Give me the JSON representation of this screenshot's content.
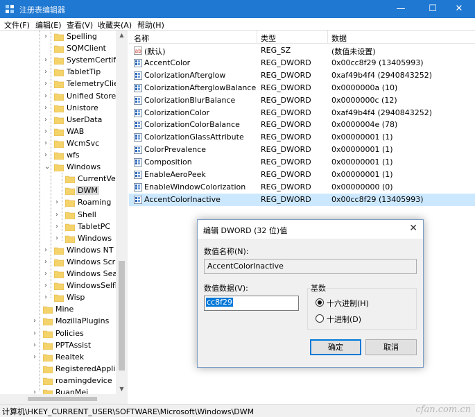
{
  "window": {
    "title": "注册表编辑器",
    "minimize": "—",
    "maximize": "☐",
    "close": "✕"
  },
  "menu": [
    "文件(F)",
    "编辑(E)",
    "查看(V)",
    "收藏夹(A)",
    "帮助(H)"
  ],
  "tree": {
    "items": [
      {
        "label": "Spelling",
        "expander": ">"
      },
      {
        "label": "SQMClient",
        "expander": ""
      },
      {
        "label": "SystemCertifi",
        "expander": ">"
      },
      {
        "label": "TabletTip",
        "expander": ">"
      },
      {
        "label": "TelemetryClie",
        "expander": ">"
      },
      {
        "label": "Unified Store",
        "expander": ">"
      },
      {
        "label": "Unistore",
        "expander": ">"
      },
      {
        "label": "UserData",
        "expander": ">"
      },
      {
        "label": "WAB",
        "expander": ">"
      },
      {
        "label": "WcmSvc",
        "expander": ">"
      },
      {
        "label": "wfs",
        "expander": ">"
      },
      {
        "label": "Windows",
        "expander": "v"
      },
      {
        "label": "CurrentVe",
        "expander": ""
      },
      {
        "label": "DWM",
        "expander": ""
      },
      {
        "label": "Roaming",
        "expander": ">"
      },
      {
        "label": "Shell",
        "expander": ">"
      },
      {
        "label": "TabletPC",
        "expander": ">"
      },
      {
        "label": "Windows",
        "expander": ">"
      },
      {
        "label": "Windows NT",
        "expander": ">"
      },
      {
        "label": "Windows Scr",
        "expander": ">"
      },
      {
        "label": "Windows Sea",
        "expander": ">"
      },
      {
        "label": "WindowsSelfl",
        "expander": ">"
      },
      {
        "label": "Wisp",
        "expander": ">"
      },
      {
        "label": "Mine",
        "expander": ""
      },
      {
        "label": "MozillaPlugins",
        "expander": ">"
      },
      {
        "label": "Policies",
        "expander": ">"
      },
      {
        "label": "PPTAssist",
        "expander": ">"
      },
      {
        "label": "Realtek",
        "expander": ">"
      },
      {
        "label": "RegisteredAppli",
        "expander": ""
      },
      {
        "label": "roamingdevice",
        "expander": ""
      },
      {
        "label": "RuanMei",
        "expander": ">"
      }
    ],
    "selected": "DWM"
  },
  "list": {
    "columns": {
      "name": "名称",
      "type": "类型",
      "data": "数据"
    },
    "rows": [
      {
        "name": "(默认)",
        "type": "REG_SZ",
        "data": "(数值未设置)",
        "icon": "string-value-icon"
      },
      {
        "name": "AccentColor",
        "type": "REG_DWORD",
        "data": "0x00cc8f29 (13405993)",
        "icon": "binary-value-icon"
      },
      {
        "name": "ColorizationAfterglow",
        "type": "REG_DWORD",
        "data": "0xaf49b4f4 (2940843252)",
        "icon": "binary-value-icon"
      },
      {
        "name": "ColorizationAfterglowBalance",
        "type": "REG_DWORD",
        "data": "0x0000000a (10)",
        "icon": "binary-value-icon"
      },
      {
        "name": "ColorizationBlurBalance",
        "type": "REG_DWORD",
        "data": "0x0000000c (12)",
        "icon": "binary-value-icon"
      },
      {
        "name": "ColorizationColor",
        "type": "REG_DWORD",
        "data": "0xaf49b4f4 (2940843252)",
        "icon": "binary-value-icon"
      },
      {
        "name": "ColorizationColorBalance",
        "type": "REG_DWORD",
        "data": "0x0000004e (78)",
        "icon": "binary-value-icon"
      },
      {
        "name": "ColorizationGlassAttribute",
        "type": "REG_DWORD",
        "data": "0x00000001 (1)",
        "icon": "binary-value-icon"
      },
      {
        "name": "ColorPrevalence",
        "type": "REG_DWORD",
        "data": "0x00000001 (1)",
        "icon": "binary-value-icon"
      },
      {
        "name": "Composition",
        "type": "REG_DWORD",
        "data": "0x00000001 (1)",
        "icon": "binary-value-icon"
      },
      {
        "name": "EnableAeroPeek",
        "type": "REG_DWORD",
        "data": "0x00000001 (1)",
        "icon": "binary-value-icon"
      },
      {
        "name": "EnableWindowColorization",
        "type": "REG_DWORD",
        "data": "0x00000000 (0)",
        "icon": "binary-value-icon"
      },
      {
        "name": "AccentColorInactive",
        "type": "REG_DWORD",
        "data": "0x00cc8f29 (13405993)",
        "icon": "binary-value-icon"
      }
    ],
    "selected": "AccentColorInactive"
  },
  "status": {
    "path": "计算机\\HKEY_CURRENT_USER\\SOFTWARE\\Microsoft\\Windows\\DWM",
    "watermark": "cfan.com.cn"
  },
  "dialog": {
    "title": "编辑 DWORD (32 位)值",
    "name_label": "数值名称(N):",
    "name_value": "AccentColorInactive",
    "data_label": "数值数据(V):",
    "data_value": "cc8f29",
    "base_label": "基数",
    "hex_label": "十六进制(H)",
    "dec_label": "十进制(D)",
    "hex_selected": true,
    "ok_label": "确定",
    "cancel_label": "取消"
  },
  "colors": {
    "titlebar": "#1f78d1",
    "selection": "#cce8ff",
    "folder": "#f5d36b",
    "accent": "#0078d7"
  }
}
